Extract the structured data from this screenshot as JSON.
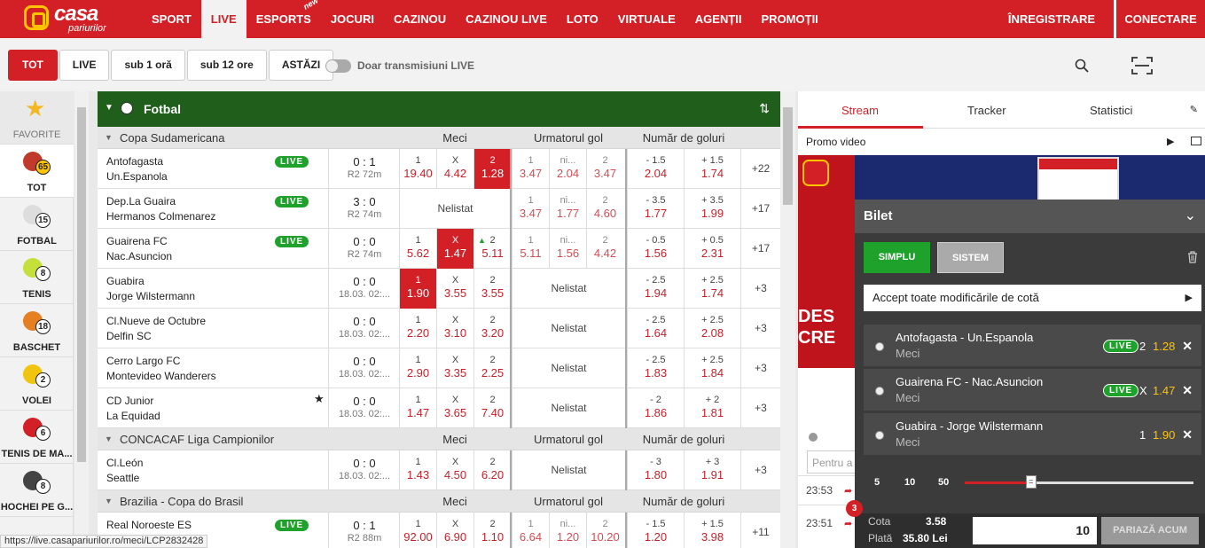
{
  "header": {
    "logo_top": "casa",
    "logo_bottom": "pariurilor",
    "nav": [
      {
        "label": "SPORT",
        "active": false
      },
      {
        "label": "LIVE",
        "active": true
      },
      {
        "label": "ESPORTS",
        "active": false,
        "badge": "new"
      },
      {
        "label": "JOCURI",
        "active": false
      },
      {
        "label": "CAZINOU",
        "active": false
      },
      {
        "label": "CAZINOU LIVE",
        "active": false
      },
      {
        "label": "LOTO",
        "active": false
      },
      {
        "label": "VIRTUALE",
        "active": false
      },
      {
        "label": "AGENȚII",
        "active": false
      },
      {
        "label": "PROMOȚII",
        "active": false
      }
    ],
    "register_label": "ÎNREGISTRARE",
    "login_label": "CONECTARE"
  },
  "filters": {
    "buttons": [
      "TOT",
      "LIVE",
      "sub 1 oră",
      "sub 12 ore",
      "ASTĂZI"
    ],
    "active": "TOT",
    "toggle_label": "Doar transmisiuni LIVE",
    "toggle_on": false
  },
  "sidebar": [
    {
      "label": "FAVORITE",
      "icon": "star-icon",
      "count": ""
    },
    {
      "label": "TOT",
      "icon": "all-sports-icon",
      "count": "65",
      "active": true
    },
    {
      "label": "FOTBAL",
      "icon": "soccer-ball-icon",
      "count": "15"
    },
    {
      "label": "TENIS",
      "icon": "tennis-ball-icon",
      "count": "8"
    },
    {
      "label": "BASCHET",
      "icon": "basketball-icon",
      "count": "18"
    },
    {
      "label": "VOLEI",
      "icon": "volleyball-icon",
      "count": "2"
    },
    {
      "label": "TENIS DE MA...",
      "icon": "table-tennis-icon",
      "count": "6"
    },
    {
      "label": "HOCHEI PE G...",
      "icon": "ice-hockey-icon",
      "count": "8"
    }
  ],
  "sport": {
    "title": "Fotbal"
  },
  "columns": {
    "meci": "Meci",
    "next_goal": "Urmatorul gol",
    "goals": "Număr de goluri"
  },
  "leagues": [
    {
      "name": "Copa Sudamericana",
      "matches": [
        {
          "home": "Antofagasta",
          "away": "Un.Espanola",
          "live": "LIVE",
          "score": "0 : 1",
          "time": "R2 72m",
          "meci": [
            {
              "l": "1",
              "v": "19.40"
            },
            {
              "l": "X",
              "v": "4.42"
            },
            {
              "l": "2",
              "v": "1.28",
              "sel": true
            }
          ],
          "next": [
            {
              "l": "1",
              "v": "3.47"
            },
            {
              "l": "ni...",
              "v": "2.04"
            },
            {
              "l": "2",
              "v": "3.47"
            }
          ],
          "goals": [
            {
              "l": "- 1.5",
              "v": "2.04"
            },
            {
              "l": "+ 1.5",
              "v": "1.74"
            }
          ],
          "more": "+22"
        },
        {
          "home": "Dep.La Guaira",
          "away": "Hermanos Colmenarez",
          "live": "LIVE",
          "score": "3 : 0",
          "time": "R2 74m",
          "meci_text": "Nelistat",
          "next": [
            {
              "l": "1",
              "v": "3.47"
            },
            {
              "l": "ni...",
              "v": "1.77"
            },
            {
              "l": "2",
              "v": "4.60"
            }
          ],
          "goals": [
            {
              "l": "- 3.5",
              "v": "1.77"
            },
            {
              "l": "+ 3.5",
              "v": "1.99"
            }
          ],
          "more": "+17"
        },
        {
          "home": "Guairena FC",
          "away": "Nac.Asuncion",
          "live": "LIVE",
          "score": "0 : 0",
          "time": "R2 74m",
          "meci": [
            {
              "l": "1",
              "v": "5.62"
            },
            {
              "l": "X",
              "v": "1.47",
              "sel": true
            },
            {
              "l": "2",
              "v": "5.11",
              "up": true
            }
          ],
          "next": [
            {
              "l": "1",
              "v": "5.11"
            },
            {
              "l": "ni...",
              "v": "1.56"
            },
            {
              "l": "2",
              "v": "4.42"
            }
          ],
          "goals": [
            {
              "l": "- 0.5",
              "v": "1.56"
            },
            {
              "l": "+ 0.5",
              "v": "2.31"
            }
          ],
          "more": "+17"
        },
        {
          "home": "Guabira",
          "away": "Jorge Wilstermann",
          "score": "0 : 0",
          "time": "18.03. 02:...",
          "meci": [
            {
              "l": "1",
              "v": "1.90",
              "sel": true
            },
            {
              "l": "X",
              "v": "3.55"
            },
            {
              "l": "2",
              "v": "3.55"
            }
          ],
          "next_text": "Nelistat",
          "goals": [
            {
              "l": "- 2.5",
              "v": "1.94"
            },
            {
              "l": "+ 2.5",
              "v": "1.74"
            }
          ],
          "more": "+3"
        },
        {
          "home": "Cl.Nueve de Octubre",
          "away": "Delfin SC",
          "score": "0 : 0",
          "time": "18.03. 02:...",
          "meci": [
            {
              "l": "1",
              "v": "2.20"
            },
            {
              "l": "X",
              "v": "3.10"
            },
            {
              "l": "2",
              "v": "3.20"
            }
          ],
          "next_text": "Nelistat",
          "goals": [
            {
              "l": "- 2.5",
              "v": "1.64"
            },
            {
              "l": "+ 2.5",
              "v": "2.08"
            }
          ],
          "more": "+3"
        },
        {
          "home": "Cerro Largo FC",
          "away": "Montevideo Wanderers",
          "score": "0 : 0",
          "time": "18.03. 02:...",
          "meci": [
            {
              "l": "1",
              "v": "2.90"
            },
            {
              "l": "X",
              "v": "3.35"
            },
            {
              "l": "2",
              "v": "2.25"
            }
          ],
          "next_text": "Nelistat",
          "goals": [
            {
              "l": "- 2.5",
              "v": "1.83"
            },
            {
              "l": "+ 2.5",
              "v": "1.84"
            }
          ],
          "more": "+3"
        },
        {
          "home": "CD Junior",
          "away": "La Equidad",
          "fav": true,
          "score": "0 : 0",
          "time": "18.03. 02:...",
          "meci": [
            {
              "l": "1",
              "v": "1.47"
            },
            {
              "l": "X",
              "v": "3.65"
            },
            {
              "l": "2",
              "v": "7.40"
            }
          ],
          "next_text": "Nelistat",
          "goals": [
            {
              "l": "- 2",
              "v": "1.86"
            },
            {
              "l": "+ 2",
              "v": "1.81"
            }
          ],
          "more": "+3"
        }
      ]
    },
    {
      "name": "CONCACAF Liga Campionilor",
      "matches": [
        {
          "home": "Cl.León",
          "away": "Seattle",
          "score": "0 : 0",
          "time": "18.03. 02:...",
          "meci": [
            {
              "l": "1",
              "v": "1.43"
            },
            {
              "l": "X",
              "v": "4.50"
            },
            {
              "l": "2",
              "v": "6.20"
            }
          ],
          "next_text": "Nelistat",
          "goals": [
            {
              "l": "- 3",
              "v": "1.80"
            },
            {
              "l": "+ 3",
              "v": "1.91"
            }
          ],
          "more": "+3"
        }
      ]
    },
    {
      "name": "Brazilia - Copa do Brasil",
      "matches": [
        {
          "home": "Real Noroeste ES",
          "away": "",
          "live": "LIVE",
          "score": "0 : 1",
          "time": "R2 88m",
          "meci": [
            {
              "l": "1",
              "v": "92.00"
            },
            {
              "l": "X",
              "v": "6.90"
            },
            {
              "l": "2",
              "v": "1.10"
            }
          ],
          "next": [
            {
              "l": "1",
              "v": "6.64"
            },
            {
              "l": "ni...",
              "v": "1.20"
            },
            {
              "l": "2",
              "v": "10.20"
            }
          ],
          "goals": [
            {
              "l": "- 1.5",
              "v": "1.20"
            },
            {
              "l": "+ 1.5",
              "v": "3.98"
            }
          ],
          "more": "+11"
        }
      ]
    }
  ],
  "right": {
    "tabs": [
      "Stream",
      "Tracker",
      "Statistici"
    ],
    "active_tab": "Stream",
    "promo_label": "Promo video",
    "video_text": "DES CRE",
    "input_placeholder": "Pentru a",
    "times": [
      "23:53",
      "23:51"
    ]
  },
  "betslip": {
    "title": "Bilet",
    "type_simple": "SIMPLU",
    "type_system": "SISTEM",
    "accept_label": "Accept toate modificările de cotă",
    "selections": [
      {
        "match": "Antofagasta - Un.Espanola",
        "market": "Meci",
        "live": "LIVE",
        "outcome": "2",
        "odd": "1.28"
      },
      {
        "match": "Guairena FC - Nac.Asuncion",
        "market": "Meci",
        "live": "LIVE",
        "outcome": "X",
        "odd": "1.47"
      },
      {
        "match": "Guabira - Jorge Wilstermann",
        "market": "Meci",
        "live": "",
        "outcome": "1",
        "odd": "1.90"
      }
    ],
    "quick_stakes": [
      "5",
      "10",
      "50"
    ],
    "slider_fraction": 0.29,
    "count": "3",
    "cota_label": "Cota",
    "cota_value": "3.58",
    "plata_label": "Plată",
    "plata_value": "35.80 Lei",
    "stake_value": "10",
    "place_label": "PARIAZĂ ACUM"
  },
  "status_url": "https://live.casapariurilor.ro/meci/LCP2832428"
}
